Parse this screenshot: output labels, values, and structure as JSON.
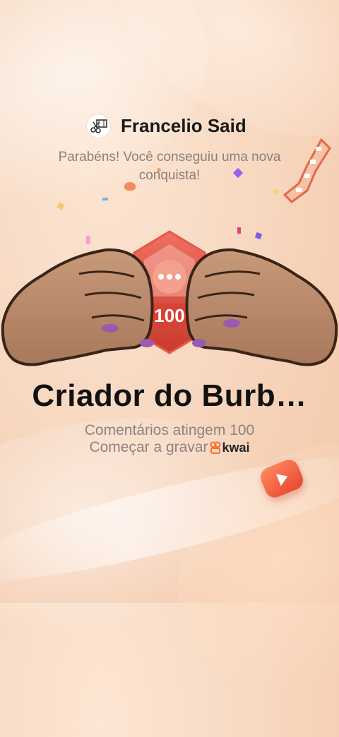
{
  "user": {
    "name": "Francelio Said",
    "avatar_icon": "scissors-film-icon"
  },
  "message": {
    "congrats": "Parabéns! Você conseguiu uma nova conquista!"
  },
  "badge": {
    "number": "100",
    "icon": "comment-badge-icon"
  },
  "achievement": {
    "title": "Criador do Burb…",
    "description": "Comentários atingem 100",
    "record_label": "Começar a gravar",
    "brand": "kwai"
  },
  "colors": {
    "accent": "#e8452c",
    "badge_red": "#d9493a",
    "text_muted": "#8d837f"
  }
}
